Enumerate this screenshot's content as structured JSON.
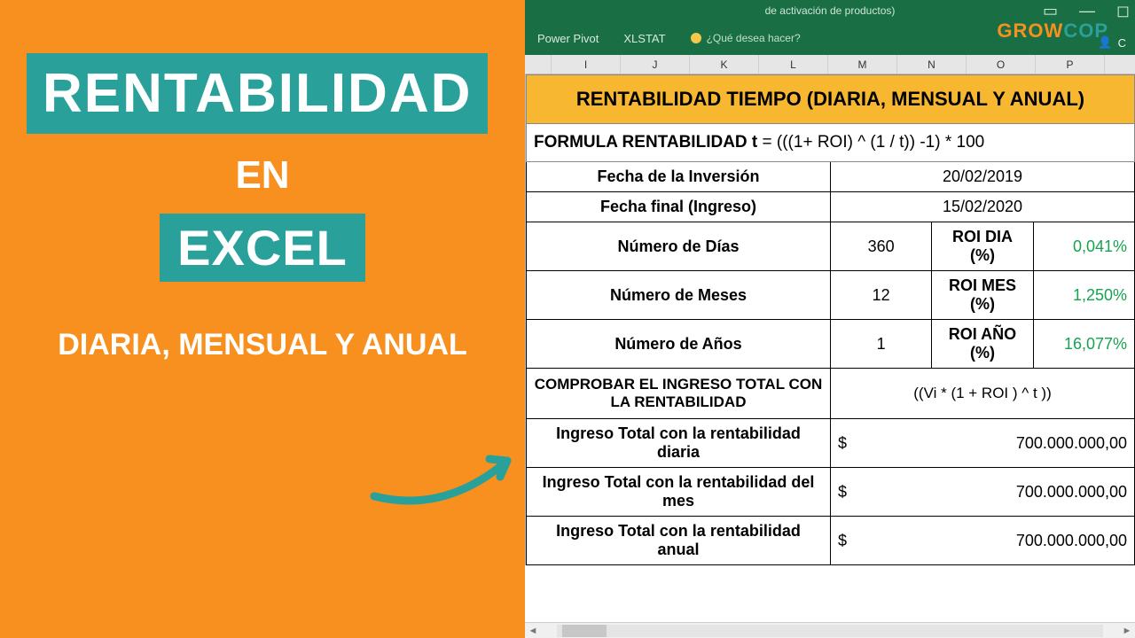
{
  "left": {
    "line1": "RENTABILIDAD",
    "en": "EN",
    "excel": "EXCEL",
    "subtitle": "DIARIA, MENSUAL Y ANUAL"
  },
  "ribbon": {
    "title_suffix": "de activación de productos)",
    "tabs": {
      "powerpivot": "Power Pivot",
      "xlstat": "XLSTAT"
    },
    "tellme": "¿Qué desea hacer?",
    "share": "C"
  },
  "brand": {
    "part1": "GROW",
    "part2": "COP"
  },
  "cols": [
    "I",
    "J",
    "K",
    "L",
    "M",
    "N",
    "O",
    "P"
  ],
  "table": {
    "header": "RENTABILIDAD TIEMPO (DIARIA, MENSUAL Y ANUAL)",
    "formula_label": "FORMULA RENTABILIDAD t",
    "formula_expr": " = (((1+ ROI) ^ (1 / t)) -1) * 100",
    "inv_date_lbl": "Fecha de la Inversión",
    "inv_date_val": "20/02/2019",
    "end_date_lbl": "Fecha final (Ingreso)",
    "end_date_val": "15/02/2020",
    "days_lbl": "Número de Días",
    "days_val": "360",
    "roi_day_lbl": "ROI DIA (%)",
    "roi_day_val": "0,041%",
    "months_lbl": "Número de Meses",
    "months_val": "12",
    "roi_mes_lbl": "ROI MES (%)",
    "roi_mes_val": "1,250%",
    "years_lbl": "Número de Años",
    "years_val": "1",
    "roi_ano_lbl": "ROI AÑO (%)",
    "roi_ano_val": "16,077%",
    "check_lbl": "COMPROBAR EL INGRESO TOTAL CON LA RENTABILIDAD",
    "check_expr": "((Vi * (1 + ROI ) ^ t ))",
    "inc_day_lbl": "Ingreso Total con la rentabilidad diaria",
    "inc_mes_lbl": "Ingreso Total con la rentabilidad del mes",
    "inc_ano_lbl": "Ingreso Total con la rentabilidad anual",
    "dollar": "$",
    "inc_val": "700.000.000,00"
  }
}
